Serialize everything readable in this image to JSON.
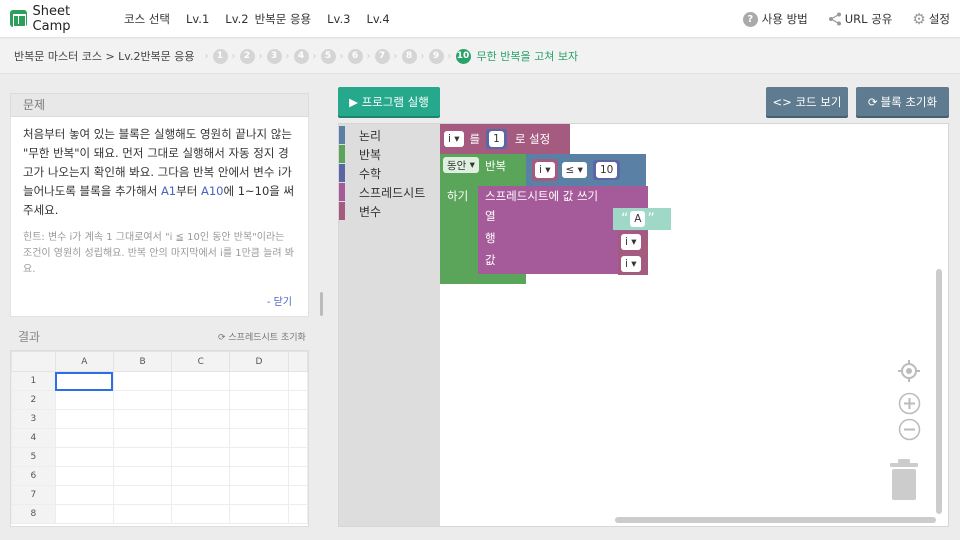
{
  "header": {
    "logo": "Sheet Camp",
    "nav": [
      "코스 선택",
      "Lv.1",
      "Lv.2",
      "반복문 응용",
      "Lv.3",
      "Lv.4"
    ],
    "help": "사용 방법",
    "share": "URL 공유",
    "settings": "설정"
  },
  "breadcrumb": {
    "path": "반복문 마스터 코스 > Lv.2반복문 응용",
    "steps": [
      "1",
      "2",
      "3",
      "4",
      "5",
      "6",
      "7",
      "8",
      "9"
    ],
    "active_step": "10",
    "active_title": "무한 반복을 고쳐 보자"
  },
  "problem": {
    "label": "문제",
    "text_1": "처음부터 놓여 있는 블록은 실행해도 영원히 끝나지 않는 \"무한 반복\"이 돼요. 먼저 그대로 실행해서 자동 정지 경고가 나오는지 확인해 봐요. 그다음 반복 안에서 변수 i가 늘어나도록 블록을 추가해서 ",
    "a1": "A1",
    "text_2": "부터 ",
    "a10": "A10",
    "text_3": "에 1~10을 써 주세요.",
    "hint": "힌트: 변수 i가 계속 1 그대로여서 \"i ≦ 10인 동안 반복\"이라는 조건이 영원히 성립해요. 반복 안의 마지막에서 i를 1만큼 늘려 봐요.",
    "close": "- 닫기"
  },
  "result": {
    "label": "결과",
    "reset_sheet": "스프레드시트 초기화",
    "columns": [
      "A",
      "B",
      "C",
      "D"
    ],
    "rows": [
      "1",
      "2",
      "3",
      "4",
      "5",
      "6",
      "7",
      "8"
    ]
  },
  "toolbar": {
    "run": "▶ 프로그램 실행",
    "code": "<> 코드 보기",
    "reset": "블록 초기화"
  },
  "toolbox": {
    "categories": [
      {
        "label": "논리",
        "color": "#5b80a5"
      },
      {
        "label": "반복",
        "color": "#5ba55b"
      },
      {
        "label": "수학",
        "color": "#5b67a5"
      },
      {
        "label": "스프레드시트",
        "color": "#a55b99"
      },
      {
        "label": "변수",
        "color": "#a55b80"
      }
    ]
  },
  "blocks": {
    "set_var": "i",
    "set_to_kw": "를",
    "set_value": "1",
    "set_kw": "로 설정",
    "while_kw": "동안",
    "loop_kw": "반복",
    "cond_var": "i",
    "cond_op": "≤",
    "cond_value": "10",
    "do_kw": "하기",
    "write_title": "스프레드시트에 값 쓰기",
    "col_kw": "열",
    "col_value": "A",
    "row_kw": "행",
    "row_var": "i",
    "val_kw": "값",
    "val_var": "i"
  },
  "colors": {
    "accent_green": "#26a88c",
    "button_gray": "#5e7b8f",
    "variable": "#a55b80",
    "loop": "#5ba55b",
    "logic": "#5b80a5",
    "math": "#5b67a5",
    "sheet": "#a55b99"
  }
}
